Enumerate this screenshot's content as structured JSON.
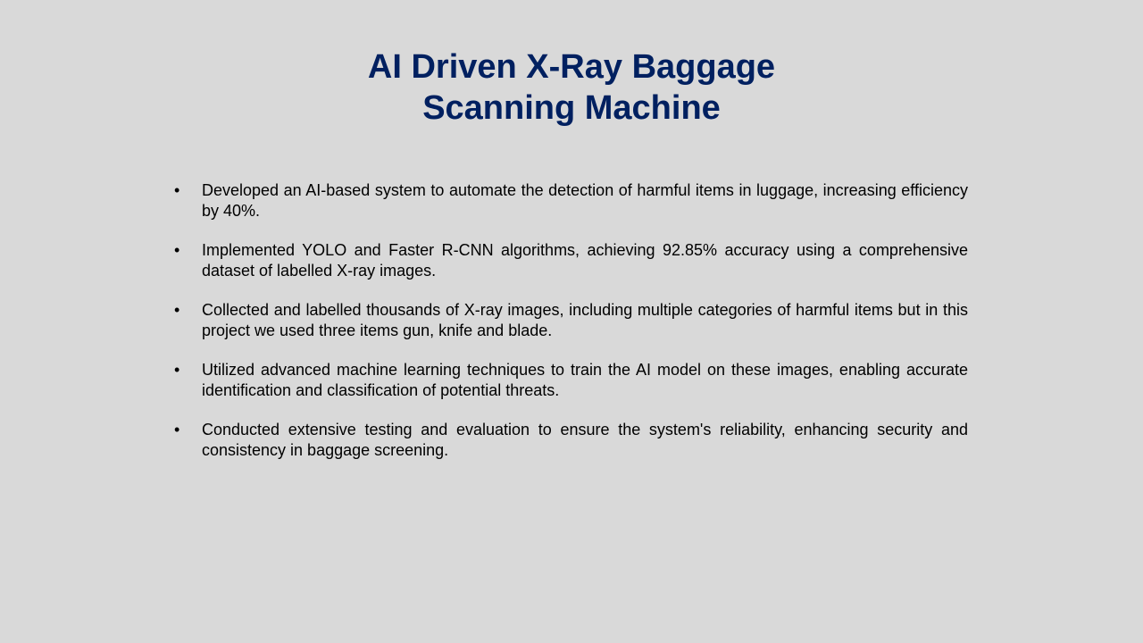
{
  "slide": {
    "title_line1": "AI Driven X-Ray Baggage",
    "title_line2": "Scanning Machine",
    "bullet_symbol": "•",
    "bullets": [
      "Developed an AI-based system to automate the detection of harmful items in luggage, increasing efficiency by 40%.",
      "Implemented YOLO and Faster R-CNN algorithms, achieving 92.85% accuracy using a comprehensive dataset of labelled X-ray images.",
      "Collected and labelled thousands of X-ray images, including multiple categories of harmful items but in this project we used three items gun, knife and blade.",
      "Utilized advanced machine learning techniques to train the AI model on these images, enabling accurate identification and classification of potential threats.",
      "Conducted extensive testing and evaluation to ensure the system's reliability, enhancing security and consistency in baggage screening."
    ]
  },
  "colors": {
    "background": "#d9d9d9",
    "title": "#002060",
    "body_text": "#000000"
  }
}
